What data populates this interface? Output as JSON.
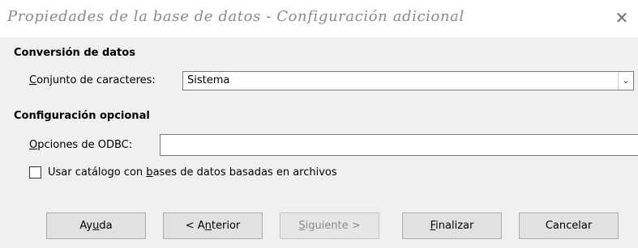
{
  "window": {
    "title": "Propiedades de la base de datos - Configuración adicional",
    "close_symbol": "✕"
  },
  "data_conversion": {
    "heading": "Conversión de datos",
    "charset_label_first": "C",
    "charset_label_rest": "onjunto de caracteres:",
    "charset_value": "Sistema"
  },
  "optional_settings": {
    "heading": "Configuración opcional",
    "odbc_label_first": "O",
    "odbc_label_rest": "pciones de ODBC:",
    "odbc_value": "",
    "catalog_checkbox": {
      "checked": false,
      "label_pre": "Usar catálogo con ",
      "label_mnemonic": "b",
      "label_post": "ases de datos basadas en archivos"
    }
  },
  "buttons": {
    "help": {
      "pre": "Ay",
      "mnemonic": "u",
      "post": "da"
    },
    "back": {
      "pre": "< A",
      "mnemonic": "n",
      "post": "terior"
    },
    "next": {
      "pre": "",
      "mnemonic": "S",
      "post": "iguiente >",
      "disabled": true
    },
    "finish": {
      "pre": "",
      "mnemonic": "F",
      "post": "inalizar"
    },
    "cancel": {
      "pre": "Cancelar",
      "mnemonic": "",
      "post": ""
    }
  }
}
